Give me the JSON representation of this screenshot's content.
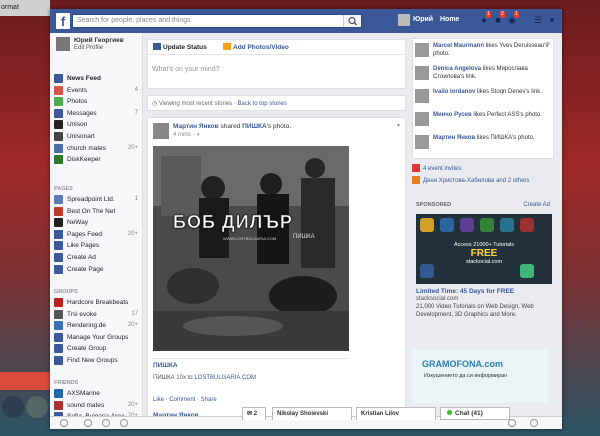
{
  "desktop": {
    "window_title_fragment": "ormat"
  },
  "topbar": {
    "logo": "f",
    "search_placeholder": "Search for people, places and things",
    "user_name": "Юрий",
    "home": "Home",
    "friend_requests_count": "1",
    "messages_count": "2",
    "notifications_count": "1"
  },
  "profile": {
    "name": "Юрий Георгиев",
    "edit": "Edit Profile"
  },
  "favorites": [
    {
      "label": "News Feed",
      "count": "",
      "color": "#3b5998",
      "active": true
    },
    {
      "label": "Events",
      "count": "4",
      "color": "#d9534f"
    },
    {
      "label": "Photos",
      "count": "",
      "color": "#4cae4c"
    },
    {
      "label": "Messages",
      "count": "7",
      "color": "#3b5998"
    },
    {
      "label": "Unison",
      "count": "",
      "color": "#222"
    },
    {
      "label": "Unisonart",
      "count": "",
      "color": "#444"
    },
    {
      "label": "church mates",
      "count": "20+",
      "color": "#4a6fa5"
    },
    {
      "label": "DiskKeeper",
      "count": "",
      "color": "#2a7a2a"
    }
  ],
  "pages_header": "PAGES",
  "pages": [
    {
      "label": "Spreadpoint Ltd.",
      "count": "1",
      "color": "#5a7ab5"
    },
    {
      "label": "Best On The Net",
      "count": "",
      "color": "#c0392b"
    },
    {
      "label": "NeWay",
      "count": "",
      "color": "#222"
    },
    {
      "label": "Pages Feed",
      "count": "20+",
      "color": "#3b5998"
    },
    {
      "label": "Like Pages",
      "count": "",
      "color": "#3b5998"
    },
    {
      "label": "Create Ad",
      "count": "",
      "color": "#3b5998"
    },
    {
      "label": "Create Page",
      "count": "",
      "color": "#3b5998"
    }
  ],
  "groups_header": "GROUPS",
  "groups": [
    {
      "label": "Hardcore Breakbeats",
      "count": "",
      "color": "#b22"
    },
    {
      "label": "Trsi evoke",
      "count": "17",
      "color": "#555"
    },
    {
      "label": "Rendering.de",
      "count": "20+",
      "color": "#3a6fb0"
    },
    {
      "label": "Manage Your Groups",
      "count": "",
      "color": "#3b5998"
    },
    {
      "label": "Create Group",
      "count": "",
      "color": "#3b5998"
    },
    {
      "label": "Find New Groups",
      "count": "",
      "color": "#3b5998"
    }
  ],
  "friends_header": "FRIENDS",
  "friends": [
    {
      "label": "AXSMarine",
      "count": "",
      "color": "#1f6aa5"
    },
    {
      "label": "sound mates",
      "count": "20+",
      "color": "#a33"
    },
    {
      "label": "Sofia, Bulgaria Area",
      "count": "20+",
      "color": "#3b5998"
    }
  ],
  "composer": {
    "tab_status": "Update Status",
    "tab_photo": "Add Photos/Video",
    "placeholder": "What's on your mind?"
  },
  "sortbar": {
    "text": "Viewing most recent stories",
    "link": "Back to top stories"
  },
  "post": {
    "author": "Мартин Янков",
    "action": "shared",
    "page": "ПИШКА",
    "suffix": "'s photo.",
    "time": "4 mins",
    "photo_title": "БОБ ДИЛЪР",
    "photo_brand": "ПИШКА",
    "photo_url": "WWW.LOSTBULGARIA.COM",
    "link_title": "ПИШКА",
    "link_src_prefix": "ПИШКА 10x to",
    "link_src": "LOSTBULGARIA.COM",
    "actions": "Like · Comment · Share",
    "next_author": "Мартин Янков"
  },
  "ticker": [
    {
      "name": "Marcel Maurmann",
      "text": "likes Yves Deruisseau's photo."
    },
    {
      "name": "Denica Angelova",
      "text": "likes Мирослава Стоилова's link."
    },
    {
      "name": "Ivailo Iordanov",
      "text": "likes Stoqn Denev's link."
    },
    {
      "name": "Минчо Русев",
      "text": "likes Perfect ASS's photo."
    },
    {
      "name": "Мартин Янков",
      "text": "likes ПИШКА's photo."
    }
  ],
  "events": {
    "invites": "4 event invites",
    "birthday_name": "Дени Христова-Хабилова",
    "birthday_rest": "and 2 others"
  },
  "sponsored": {
    "header": "SPONSORED",
    "create_ad": "Create Ad",
    "ad1_access": "Access 21000+ Tutorials",
    "ad1_free": "FREE",
    "ad1_site": "stackocial.com",
    "ad1_title": "Limited Time: 45 Days for FREE",
    "ad1_url": "stacksocial.com",
    "ad1_desc": "21,000 Video Tutorials on Web Design, Web Development, 3D Graphics and More.",
    "ad2_logo": "GRAMOFONA.com",
    "ad2_sub": "Изкушението да си информиран"
  },
  "chat": {
    "tab1_count": "2",
    "tab2": "Nikolay Shoievski",
    "tab3": "Kristian Lilov",
    "main": "Chat (41)"
  }
}
